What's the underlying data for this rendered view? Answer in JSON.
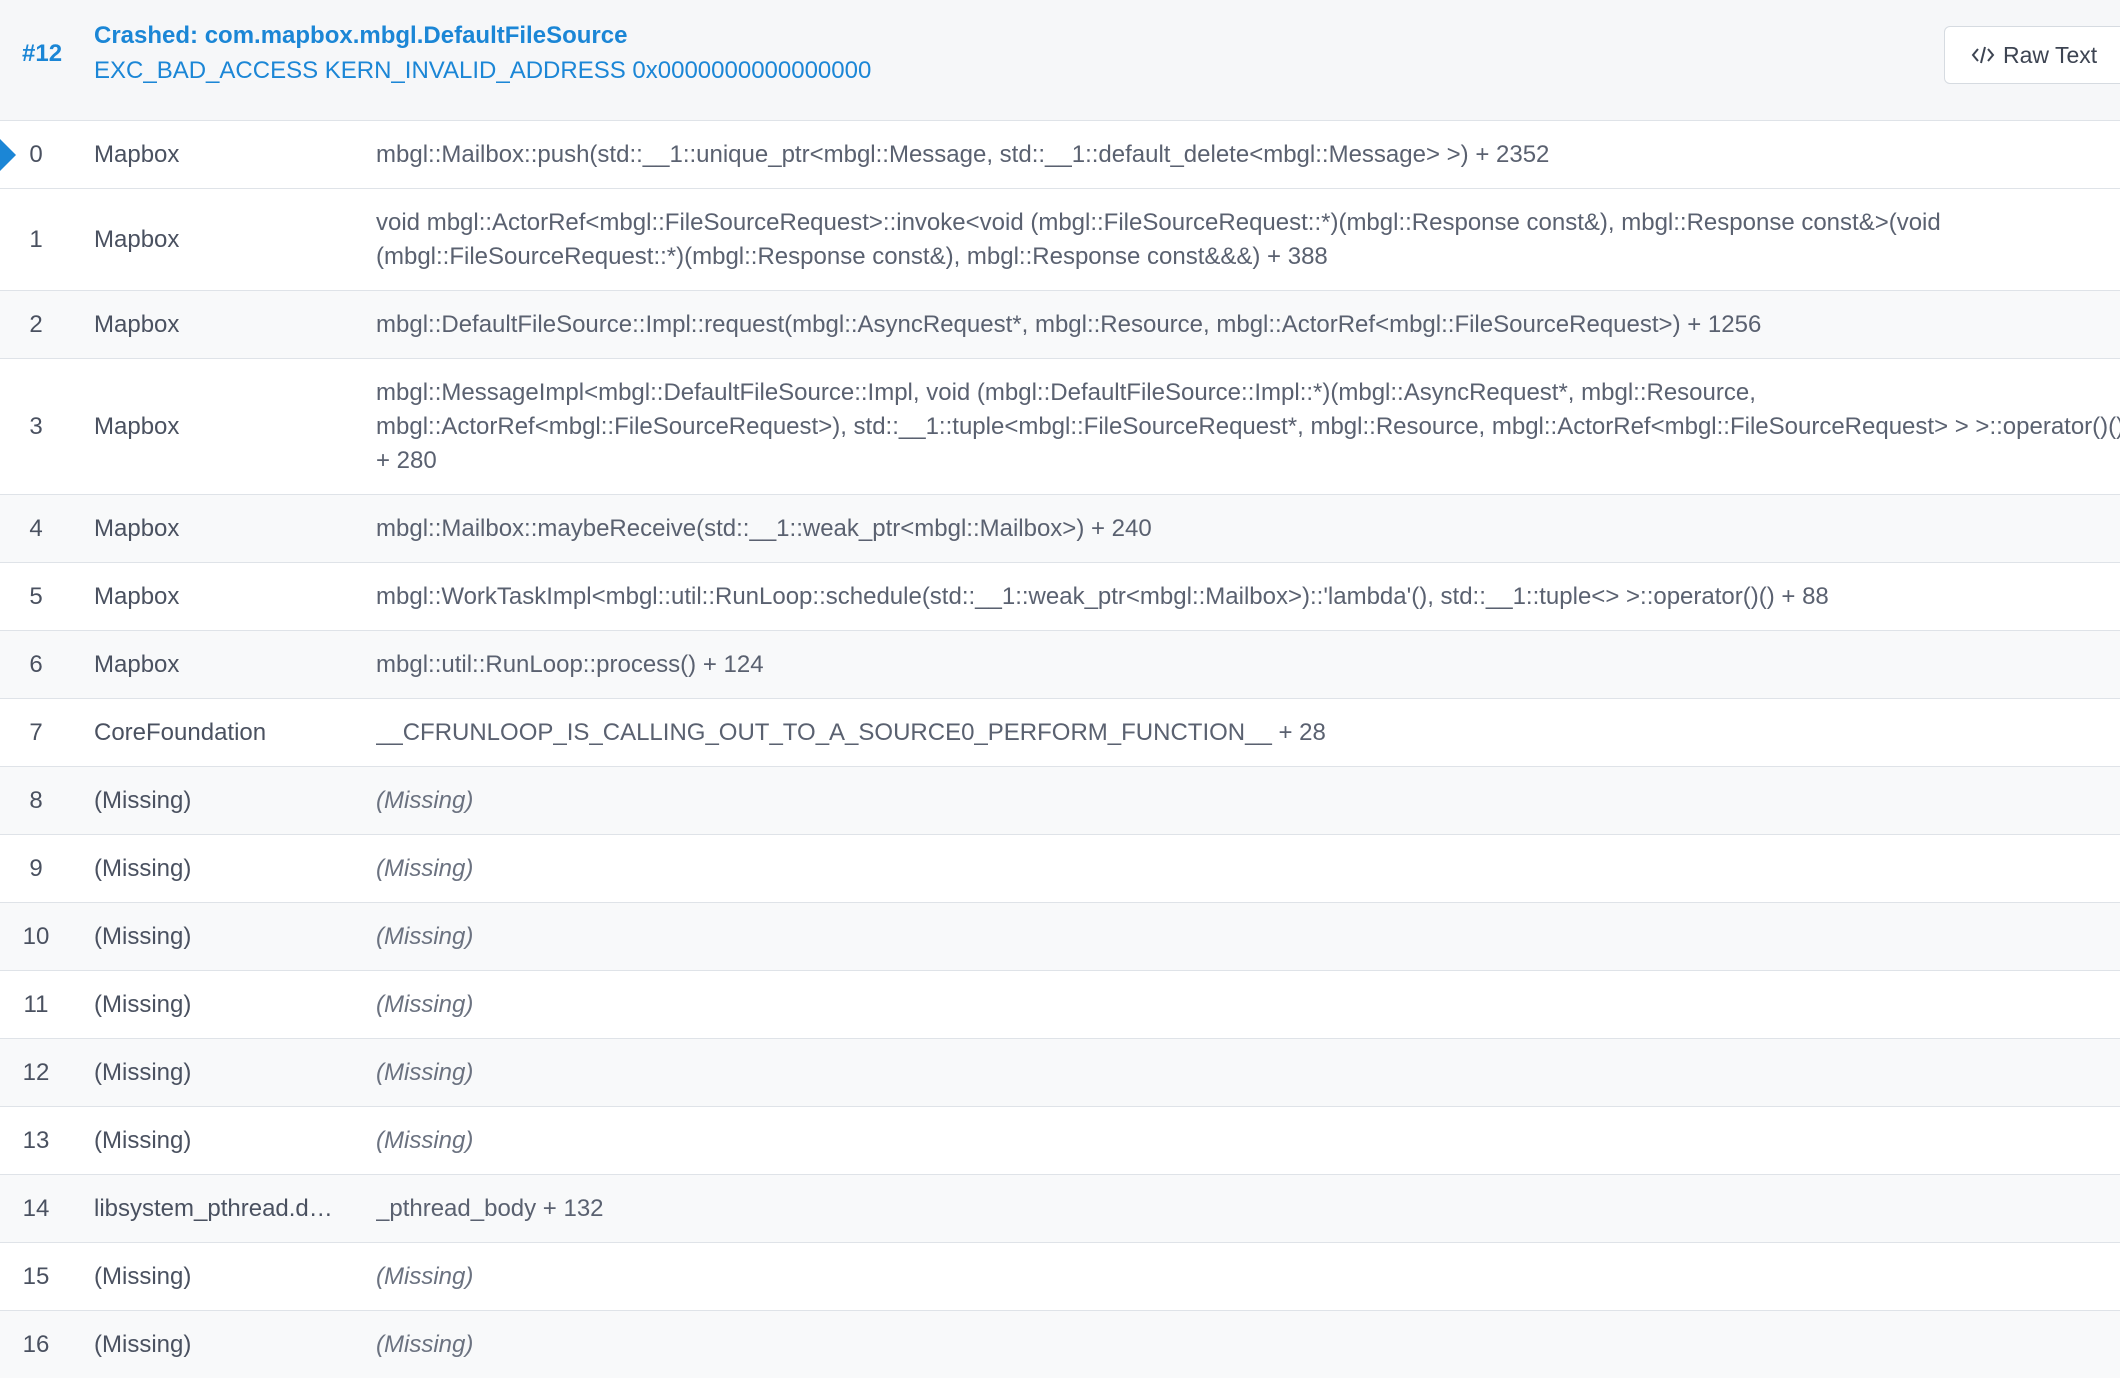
{
  "header": {
    "thread_number": "#12",
    "crash_title": "Crashed: com.mapbox.mbgl.DefaultFileSource",
    "crash_reason": "EXC_BAD_ACCESS KERN_INVALID_ADDRESS 0x0000000000000000",
    "raw_text_button": "Raw Text",
    "raw_text_icon": "code-icon"
  },
  "colors": {
    "accent": "#1b86d6",
    "header_bg": "#f6f7f9",
    "row_alt_bg": "#f8f9fa",
    "border": "#dfe3e8"
  },
  "frames": [
    {
      "index": "0",
      "library": "Mapbox",
      "symbol": "mbgl::Mailbox::push(std::__1::unique_ptr<mbgl::Message, std::__1::default_delete<mbgl::Message> >) + 2352",
      "missing": false,
      "current": true
    },
    {
      "index": "1",
      "library": "Mapbox",
      "symbol": "void mbgl::ActorRef<mbgl::FileSourceRequest>::invoke<void (mbgl::FileSourceRequest::*)(mbgl::Response const&), mbgl::Response const&>(void (mbgl::FileSourceRequest::*)(mbgl::Response const&), mbgl::Response const&&&) + 388",
      "missing": false
    },
    {
      "index": "2",
      "library": "Mapbox",
      "symbol": "mbgl::DefaultFileSource::Impl::request(mbgl::AsyncRequest*, mbgl::Resource, mbgl::ActorRef<mbgl::FileSourceRequest>) + 1256",
      "missing": false
    },
    {
      "index": "3",
      "library": "Mapbox",
      "symbol_lines": [
        "mbgl::MessageImpl<mbgl::DefaultFileSource::Impl, void (mbgl::DefaultFileSource::Impl::*)(mbgl::AsyncRequest*, mbgl::Resource,",
        "mbgl::ActorRef<mbgl::FileSourceRequest>), std::__1::tuple<mbgl::FileSourceRequest*, mbgl::Resource, mbgl::ActorRef<mbgl::FileSourceRequest> > >::operator()()",
        "+ 280"
      ],
      "missing": false
    },
    {
      "index": "4",
      "library": "Mapbox",
      "symbol": "mbgl::Mailbox::maybeReceive(std::__1::weak_ptr<mbgl::Mailbox>) + 240",
      "missing": false
    },
    {
      "index": "5",
      "library": "Mapbox",
      "symbol": "mbgl::WorkTaskImpl<mbgl::util::RunLoop::schedule(std::__1::weak_ptr<mbgl::Mailbox>)::'lambda'(), std::__1::tuple<> >::operator()() + 88",
      "missing": false
    },
    {
      "index": "6",
      "library": "Mapbox",
      "symbol": "mbgl::util::RunLoop::process() + 124",
      "missing": false
    },
    {
      "index": "7",
      "library": "CoreFoundation",
      "symbol": "__CFRUNLOOP_IS_CALLING_OUT_TO_A_SOURCE0_PERFORM_FUNCTION__ + 28",
      "missing": false
    },
    {
      "index": "8",
      "library": "(Missing)",
      "symbol": "(Missing)",
      "missing": true
    },
    {
      "index": "9",
      "library": "(Missing)",
      "symbol": "(Missing)",
      "missing": true
    },
    {
      "index": "10",
      "library": "(Missing)",
      "symbol": "(Missing)",
      "missing": true
    },
    {
      "index": "11",
      "library": "(Missing)",
      "symbol": "(Missing)",
      "missing": true
    },
    {
      "index": "12",
      "library": "(Missing)",
      "symbol": "(Missing)",
      "missing": true
    },
    {
      "index": "13",
      "library": "(Missing)",
      "symbol": "(Missing)",
      "missing": true
    },
    {
      "index": "14",
      "library": "libsystem_pthread.d…",
      "symbol": "_pthread_body + 132",
      "missing": false
    },
    {
      "index": "15",
      "library": "(Missing)",
      "symbol": "(Missing)",
      "missing": true
    },
    {
      "index": "16",
      "library": "(Missing)",
      "symbol": "(Missing)",
      "missing": true
    }
  ]
}
